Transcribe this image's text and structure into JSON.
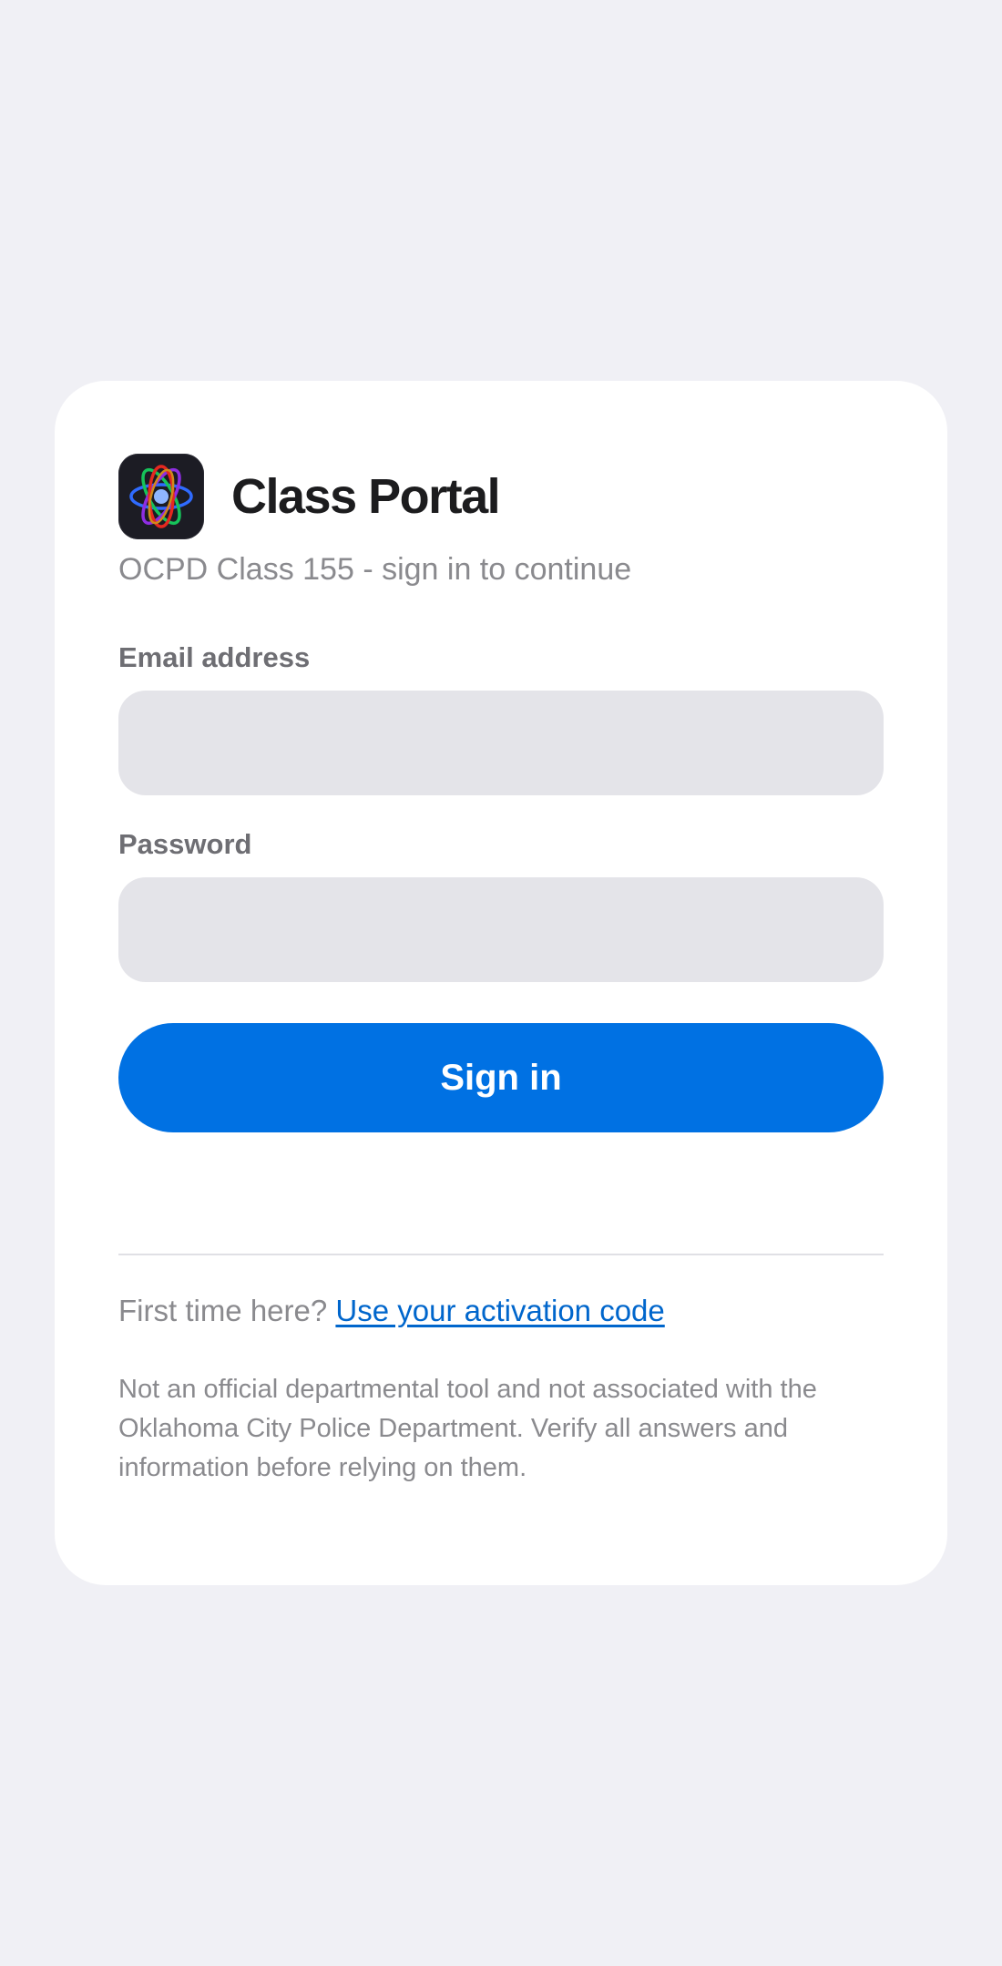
{
  "app": {
    "title": "Class Portal",
    "subtitle": "OCPD Class 155 - sign in to continue",
    "icon": "atom-icon"
  },
  "form": {
    "email_label": "Email address",
    "email_value": "",
    "email_placeholder": "",
    "password_label": "Password",
    "password_value": "",
    "password_placeholder": "",
    "signin_label": "Sign in"
  },
  "footer": {
    "first_time_text": "First time here?",
    "activation_link": "Use your activation code",
    "disclaimer": "Not an official departmental tool and not associated with the Oklahoma City Police Department. Verify all answers and information before relying on them."
  },
  "colors": {
    "background": "#f0f0f5",
    "card": "#ffffff",
    "accent": "#0071e3",
    "link": "#0066cc",
    "input_fill": "#e4e4e9"
  }
}
